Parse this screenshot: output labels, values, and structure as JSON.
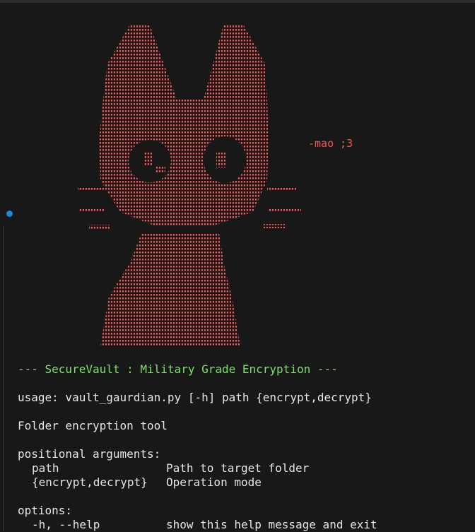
{
  "colors": {
    "background": "#181818",
    "ascii_art": "#f25757",
    "banner": "#7ee06b",
    "text": "#e6e6e6",
    "cursor_dot": "#1e88d4"
  },
  "ascii_art": {
    "subject": "cat head and body made of dots",
    "caption": "-mao ;3"
  },
  "terminal": {
    "banner": "--- SecureVault : Military Grade Encryption ---",
    "usage": "usage: vault_gaurdian.py [-h] path {encrypt,decrypt}",
    "description": "Folder encryption tool",
    "positional_header": "positional arguments:",
    "positional": [
      {
        "name": "path",
        "help": "Path to target folder"
      },
      {
        "name": "{encrypt,decrypt}",
        "help": "Operation mode"
      }
    ],
    "options_header": "options:",
    "options": [
      {
        "name": "-h, --help",
        "help": "show this help message and exit"
      }
    ]
  }
}
